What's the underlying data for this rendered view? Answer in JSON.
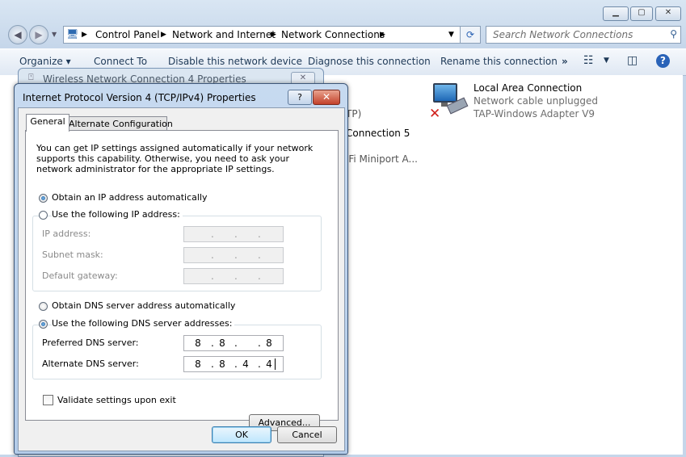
{
  "explorer": {
    "address_crumbs": [
      "Control Panel",
      "Network and Internet",
      "Network Connections"
    ],
    "search_placeholder": "Search Network Connections",
    "toolbar": {
      "organize": "Organize",
      "connect_to": "Connect To",
      "disable": "Disable this network device",
      "diagnose": "Diagnose this connection",
      "rename": "Rename this connection",
      "more": "»"
    },
    "content": {
      "item_partial_1": "TP)",
      "item_partial_2": "Connection 5",
      "item_partial_3": "iFi Miniport A...",
      "local_area": {
        "name": "Local Area Connection",
        "status": "Network cable unplugged",
        "adapter": "TAP-Windows Adapter V9"
      }
    }
  },
  "wireless_dialog": {
    "title": "Wireless Network Connection 4 Properties"
  },
  "dialog": {
    "title": "Internet Protocol Version 4 (TCP/IPv4) Properties",
    "help": "?",
    "close": "✕",
    "tabs": [
      "General",
      "Alternate Configuration"
    ],
    "description": "You can get IP settings assigned automatically if your network supports this capability. Otherwise, you need to ask your network administrator for the appropriate IP settings.",
    "ip_auto": "Obtain an IP address automatically",
    "ip_manual": "Use the following IP address:",
    "ip_address_label": "IP address:",
    "subnet_label": "Subnet mask:",
    "gateway_label": "Default gateway:",
    "dns_auto": "Obtain DNS server address automatically",
    "dns_manual": "Use the following DNS server addresses:",
    "preferred_label": "Preferred DNS server:",
    "alternate_label": "Alternate DNS server:",
    "preferred": [
      "8",
      "8",
      "",
      "8"
    ],
    "alternate": [
      "8",
      "8",
      "4",
      "4"
    ],
    "validate": "Validate settings upon exit",
    "advanced": "Advanced...",
    "ok": "OK",
    "cancel": "Cancel"
  }
}
